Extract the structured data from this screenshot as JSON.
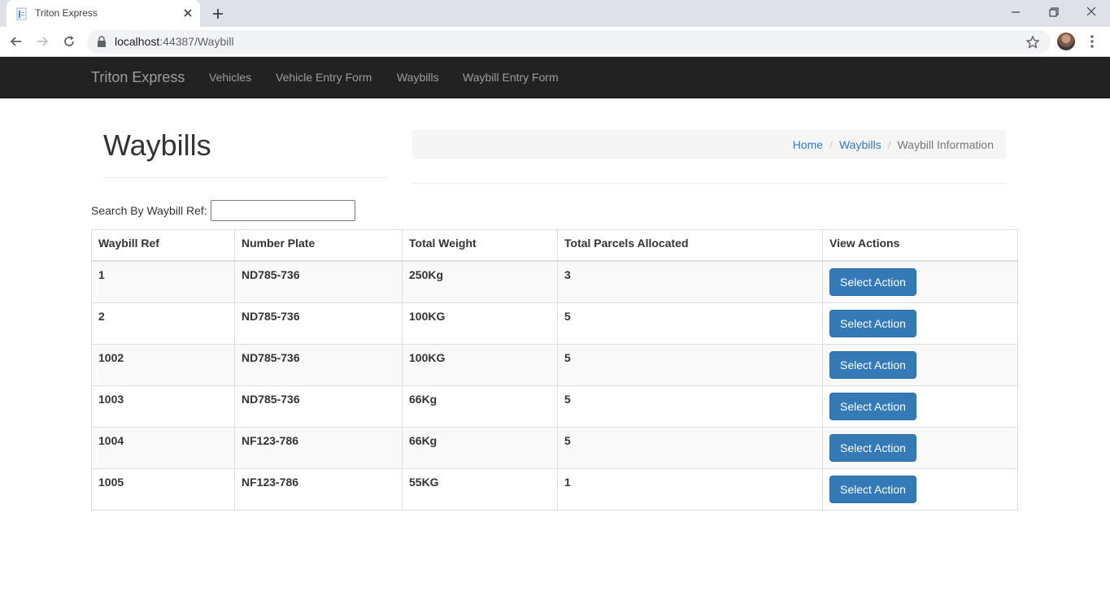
{
  "browser": {
    "tab_title": "Triton Express",
    "url_host": "localhost",
    "url_path": ":44387/Waybill"
  },
  "navbar": {
    "brand": "Triton Express",
    "links": [
      "Vehicles",
      "Vehicle Entry Form",
      "Waybills",
      "Waybill Entry Form"
    ]
  },
  "page": {
    "title": "Waybills"
  },
  "breadcrumb": {
    "home": "Home",
    "waybills": "Waybills",
    "active": "Waybill Information"
  },
  "search": {
    "label": "Search By Waybill Ref:",
    "value": ""
  },
  "table": {
    "headers": [
      "Waybill Ref",
      "Number Plate",
      "Total Weight",
      "Total Parcels Allocated",
      "View Actions"
    ],
    "rows": [
      {
        "ref": "1",
        "plate": "ND785-736",
        "weight": "250Kg",
        "parcels": "3",
        "action": "Select Action"
      },
      {
        "ref": "2",
        "plate": "ND785-736",
        "weight": "100KG",
        "parcels": "5",
        "action": "Select Action"
      },
      {
        "ref": "1002",
        "plate": "ND785-736",
        "weight": "100KG",
        "parcels": "5",
        "action": "Select Action"
      },
      {
        "ref": "1003",
        "plate": "ND785-736",
        "weight": "66Kg",
        "parcels": "5",
        "action": "Select Action"
      },
      {
        "ref": "1004",
        "plate": "NF123-786",
        "weight": "66Kg",
        "parcels": "5",
        "action": "Select Action"
      },
      {
        "ref": "1005",
        "plate": "NF123-786",
        "weight": "55KG",
        "parcels": "1",
        "action": "Select Action"
      }
    ]
  },
  "colors": {
    "navbar_bg": "#222222",
    "primary": "#337ab7",
    "link": "#337ab7"
  }
}
